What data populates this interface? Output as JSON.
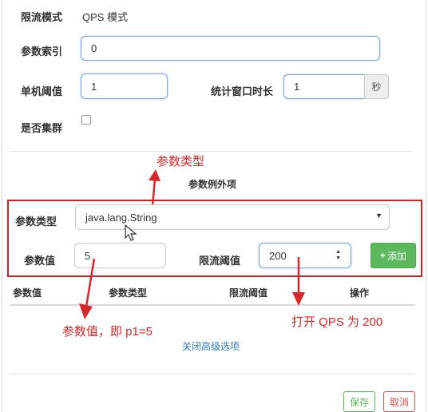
{
  "form": {
    "mode_label": "限流模式",
    "mode_value": "QPS 模式",
    "param_index_label": "参数索引",
    "param_index_value": "0",
    "single_threshold_label": "单机阈值",
    "single_threshold_value": "1",
    "window_label": "统计窗口时长",
    "window_value": "1",
    "window_unit": "秒",
    "cluster_label": "是否集群"
  },
  "exception": {
    "section_title": "参数例外项",
    "param_type_label": "参数类型",
    "param_type_value": "java.lang.String",
    "param_value_label": "参数值",
    "param_value": "5",
    "limit_label": "限流阈值",
    "limit_value": "200",
    "add_button": "添加",
    "table_headers": [
      "参数值",
      "参数类型",
      "限流阈值",
      "操作"
    ]
  },
  "links": {
    "close_advanced": "关闭高级选项"
  },
  "footer": {
    "save": "保存",
    "cancel": "取消"
  },
  "annotations": {
    "param_type": "参数类型",
    "param_value": "参数值，即 p1=5",
    "qps": "打开 QPS 为 200"
  },
  "colors": {
    "annotation_red": "#d8262a",
    "add_green": "#5cb85c",
    "link_blue": "#337ab7"
  }
}
